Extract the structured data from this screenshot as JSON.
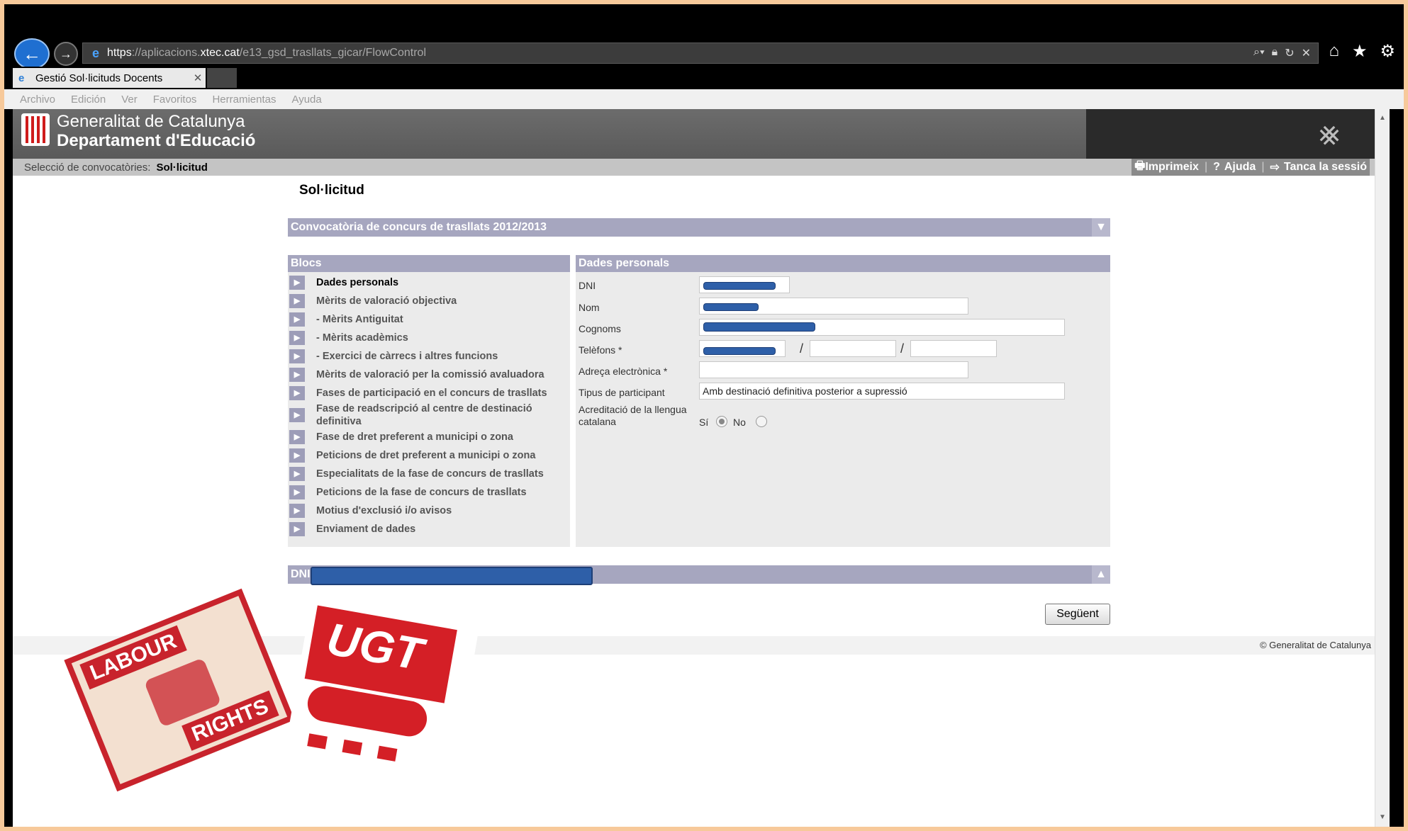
{
  "browser": {
    "url_scheme": "https",
    "url_host_prefix": "://aplicacions.",
    "url_host_main": "xtec.cat",
    "url_path": "/e13_gsd_trasllats_gicar/FlowControl",
    "tab_title": "Gestió Sol·licituds Docents",
    "menu": [
      "Archivo",
      "Edición",
      "Ver",
      "Favoritos",
      "Herramientas",
      "Ayuda"
    ]
  },
  "header": {
    "org_name": "Generalitat de Catalunya",
    "dept_name": "Departament d'Educació",
    "breadcrumb_label": "Selecció de convocatòries:",
    "breadcrumb_current": "Sol·licitud",
    "links": [
      "Imprimeix",
      "Ajuda",
      "Tanca la sessió"
    ]
  },
  "page": {
    "title": "Sol·licitud",
    "convocatoria": "Convocatòria de concurs de trasllats 2012/2013",
    "blocs_title": "Blocs",
    "blocs": [
      "Dades personals",
      "Mèrits de valoració objectiva",
      "- Mèrits Antiguitat",
      "- Mèrits acadèmics",
      "- Exercici de càrrecs i altres funcions",
      "Mèrits de valoració per la comissió avaluadora",
      "Fases de participació en el concurs de trasllats",
      "Fase de readscripció al centre de destinació definitiva",
      "Fase de dret preferent a municipi o zona",
      "Peticions de dret preferent a municipi o zona",
      "Especialitats de la fase de concurs de trasllats",
      "Peticions de la fase de concurs de trasllats",
      "Motius d'exclusió i/o avisos",
      "Enviament de dades"
    ],
    "dades_title": "Dades personals",
    "fields": {
      "dni": "DNI",
      "nom": "Nom",
      "cognoms": "Cognoms",
      "telefons": "Telèfons *",
      "email": "Adreça electrònica *",
      "tipus": "Tipus de participant",
      "tipus_value": "Amb destinació definitiva posterior a supressió",
      "acreditacio": "Acreditació de la llengua catalana",
      "si": "Sí",
      "no": "No",
      "acreditacio_value": "Sí"
    },
    "dni_band": "DNI",
    "next_button": "Següent",
    "footer": "© Generalitat de Catalunya"
  },
  "overlays": {
    "labour_top": "LABOUR",
    "labour_bottom": "RIGHTS",
    "ugt": "UGT"
  },
  "colors": {
    "band": "#a6a6bf",
    "redaction": "#2e5fa8",
    "ugt_red": "#d41f26"
  }
}
